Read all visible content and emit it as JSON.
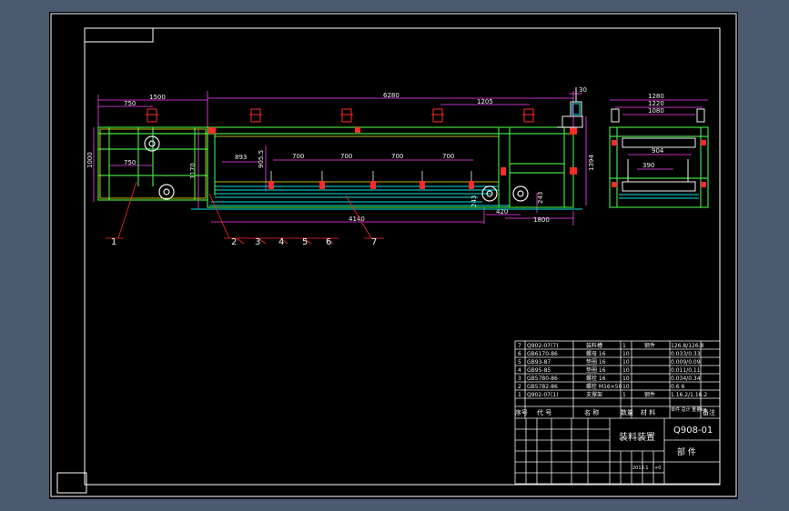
{
  "colors": {
    "app_background": "#4a5a70",
    "sheet": "#000000",
    "border": "#ffffff",
    "frame_green": "#3fe03f",
    "cyan": "#00e5e5",
    "red": "#ff2a2a",
    "magenta": "#ff40ff",
    "yellow": "#f2f200"
  },
  "front_view": {
    "dimensions": [
      "1500",
      "750",
      "6280",
      "1205",
      "30",
      "1000",
      "750",
      "1170",
      "893",
      "905.5",
      "700",
      "700",
      "700",
      "700",
      "4140",
      "243",
      "420",
      "243",
      "1800",
      "1394"
    ]
  },
  "side_view": {
    "dimensions": [
      "1280",
      "1220",
      "1080",
      "904",
      "390"
    ]
  },
  "balloons": [
    "1",
    "2",
    "3",
    "4",
    "5",
    "6",
    "7"
  ],
  "title_block": {
    "parts_rows": [
      {
        "no": "7",
        "code": "Q902-07(7)",
        "name": "装料槽",
        "qty": "1",
        "material": "钢件",
        "weight": "126.8/126.8"
      },
      {
        "no": "6",
        "code": "GB6170-86",
        "name": "螺母 16",
        "qty": "10",
        "material": "",
        "weight": "0.033/0.33"
      },
      {
        "no": "5",
        "code": "GB93-87",
        "name": "垫圈 16",
        "qty": "10",
        "material": "",
        "weight": "0.009/0.09"
      },
      {
        "no": "4",
        "code": "GB95-85",
        "name": "垫圈 16",
        "qty": "10",
        "material": "",
        "weight": "0.011/0.11"
      },
      {
        "no": "3",
        "code": "GB5780-86",
        "name": "螺栓 16",
        "qty": "10",
        "material": "",
        "weight": "0.034/0.34"
      },
      {
        "no": "2",
        "code": "GB5782-86",
        "name": "螺栓 M16×50",
        "qty": "10",
        "material": "",
        "weight": "0.6    6"
      },
      {
        "no": "1",
        "code": "Q902-07(1)",
        "name": "支撑架",
        "qty": "1",
        "material": "钢件",
        "weight": "1.16.2/1.16.2"
      }
    ],
    "header": {
      "seq": "序号",
      "code": "代 号",
      "name": "名 称",
      "qty": "数量",
      "material": "材 料",
      "weight": "单件 总计 重量kg",
      "remark": "备注"
    },
    "drawing_title": "装料装置",
    "drawing_code": "Q908-01",
    "drawing_type": "部 件",
    "date_label": "2013.1 ",
    "mark": "+0"
  }
}
